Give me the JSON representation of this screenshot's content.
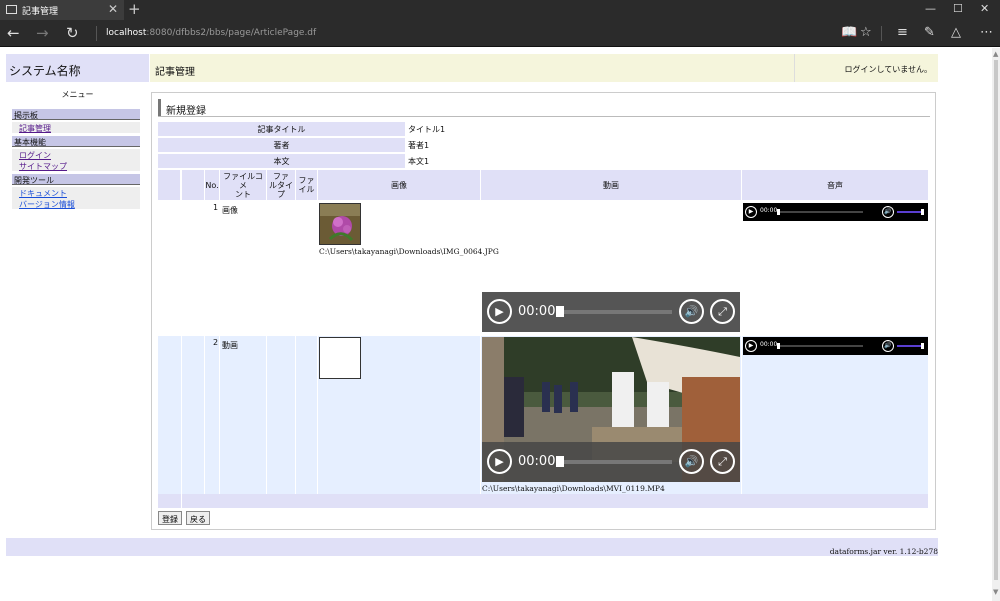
{
  "browser": {
    "tab_title": "記事管理",
    "tab_close": "✕",
    "new_tab": "+",
    "url_host": "localhost",
    "url_path": ":8080/dfbbs2/bbs/page/ArticlePage.df"
  },
  "app": {
    "system_name": "システム名称",
    "page_title": "記事管理",
    "login_status": "ログインしていません。"
  },
  "menu": {
    "title": "メニュー",
    "groups": [
      {
        "label": "掲示板",
        "items": [
          "記事管理"
        ]
      },
      {
        "label": "基本機能",
        "items": [
          "ログイン",
          "サイトマップ"
        ]
      },
      {
        "label": "開発ツール",
        "items": [
          "ドキュメント",
          "バージョン情報"
        ]
      }
    ]
  },
  "form": {
    "section_title": "新規登録",
    "fields": [
      {
        "label": "記事タイトル",
        "value": "タイトル1"
      },
      {
        "label": "著者",
        "value": "著者1"
      },
      {
        "label": "本文",
        "value": "本文1"
      }
    ]
  },
  "table": {
    "headers": {
      "no": "No.",
      "file_comment_1": "ファイルコメ",
      "file_comment_2": "ント",
      "file_type_1": "ファ",
      "file_type_2": "ルタイ",
      "file_type_3": "プ",
      "file_1": "ファ",
      "file_2": "イル",
      "image": "画像",
      "video": "動画",
      "audio": "音声"
    },
    "rows": [
      {
        "no": "1",
        "comment": "画像",
        "image_path": "C:\\Users\\takayanagi\\Downloads\\IMG_0064.JPG",
        "video_path": ""
      },
      {
        "no": "2",
        "comment": "動画",
        "image_path": "",
        "video_path": "C:\\Users\\takayanagi\\Downloads\\MVI_0119.MP4"
      }
    ]
  },
  "media": {
    "audio_time": "00:00",
    "video_time": "00:00"
  },
  "buttons": {
    "register": "登録",
    "back": "戻る"
  },
  "footer": {
    "version": "dataforms.jar ver. 1.12-b278"
  },
  "colors": {
    "header_bg": "#e0e0f7",
    "title_bg": "#f5f5dc",
    "audio_volume": "#5b3fd1"
  }
}
